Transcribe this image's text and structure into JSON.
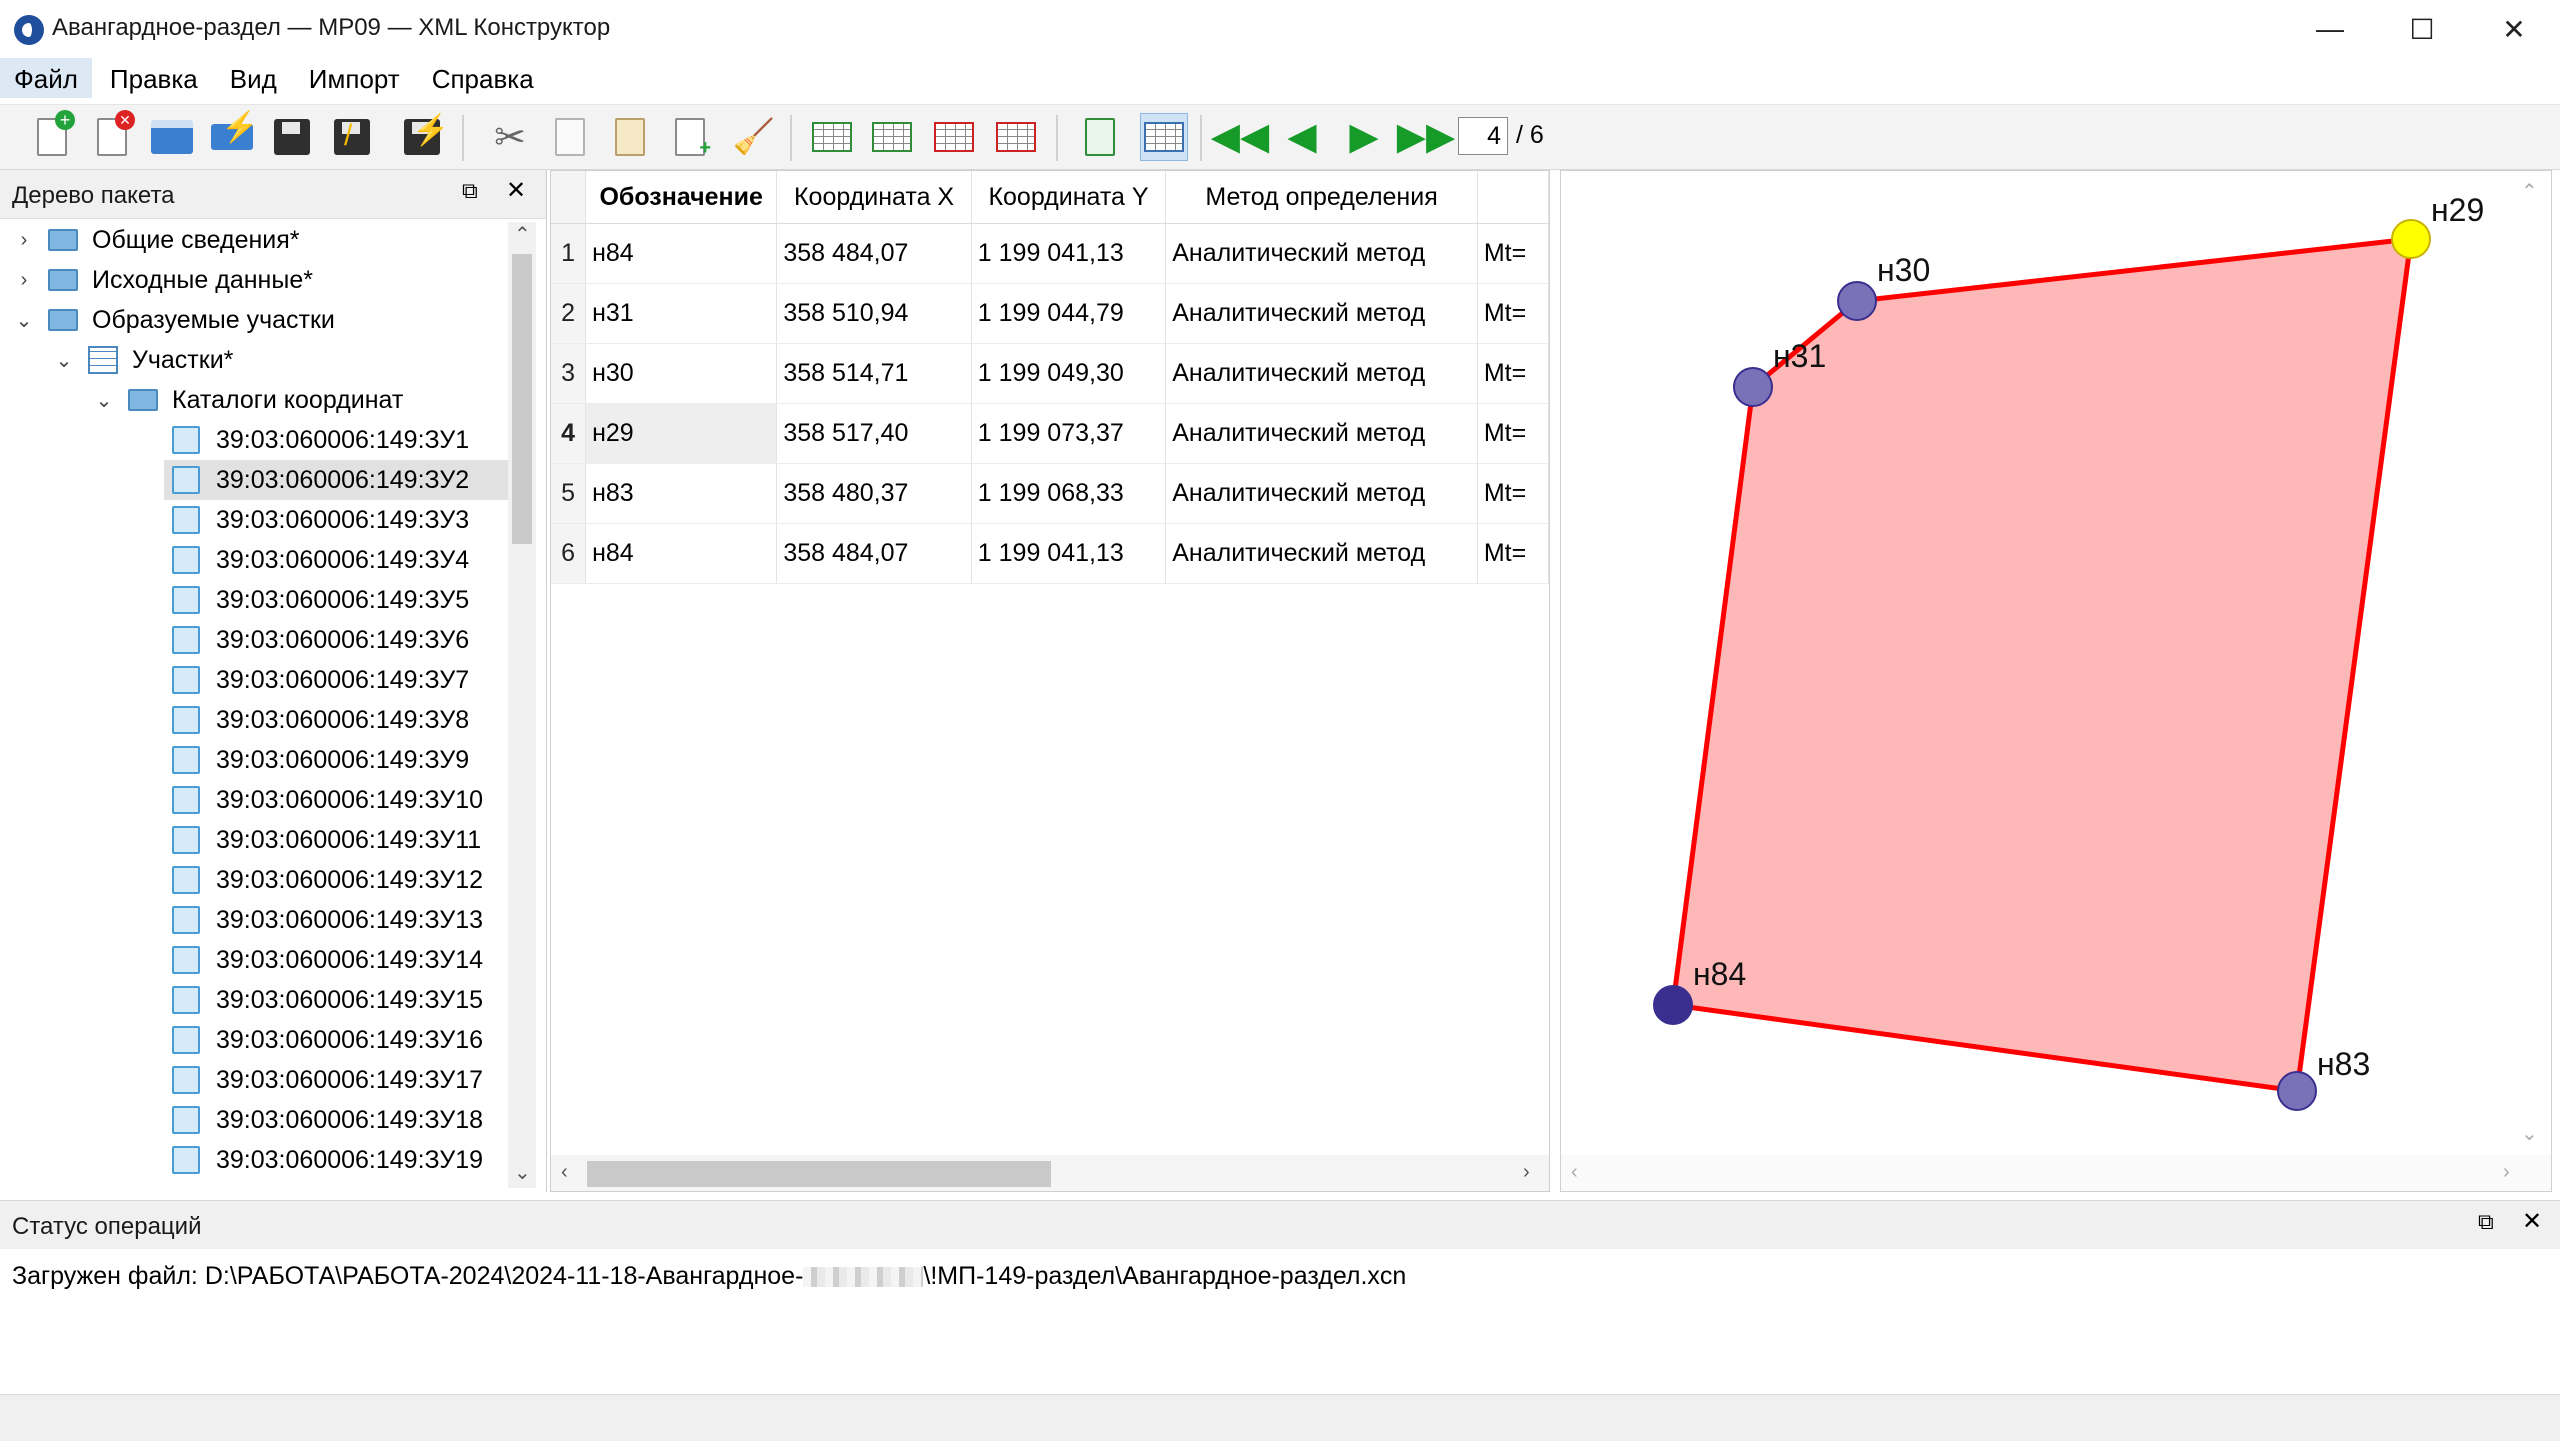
{
  "window": {
    "title": "Авангардное-раздел — МР09 — XML Конструктор",
    "min_icon": "—",
    "max_icon": "☐",
    "close_icon": "✕"
  },
  "menu": [
    "Файл",
    "Правка",
    "Вид",
    "Импорт",
    "Справка"
  ],
  "toolbar": {
    "page_current": "4",
    "page_total": "/ 6"
  },
  "tree": {
    "title": "Дерево пакета",
    "nodes": [
      {
        "label": "Общие сведения*"
      },
      {
        "label": "Исходные данные*"
      },
      {
        "label": "Образуемые участки"
      },
      {
        "label": "Участки*"
      },
      {
        "label": "Каталоги координат"
      }
    ],
    "items": [
      "39:03:060006:149:ЗУ1",
      "39:03:060006:149:ЗУ2",
      "39:03:060006:149:ЗУ3",
      "39:03:060006:149:ЗУ4",
      "39:03:060006:149:ЗУ5",
      "39:03:060006:149:ЗУ6",
      "39:03:060006:149:ЗУ7",
      "39:03:060006:149:ЗУ8",
      "39:03:060006:149:ЗУ9",
      "39:03:060006:149:ЗУ10",
      "39:03:060006:149:ЗУ11",
      "39:03:060006:149:ЗУ12",
      "39:03:060006:149:ЗУ13",
      "39:03:060006:149:ЗУ14",
      "39:03:060006:149:ЗУ15",
      "39:03:060006:149:ЗУ16",
      "39:03:060006:149:ЗУ17",
      "39:03:060006:149:ЗУ18",
      "39:03:060006:149:ЗУ19"
    ],
    "selected_index": 1
  },
  "table": {
    "headers": [
      "Обозначение",
      "Координата X",
      "Координата Y",
      "Метод определения",
      ""
    ],
    "rows": [
      {
        "n": "1",
        "name": "н84",
        "x": "358 484,07",
        "y": "1 199 041,13",
        "method": "Аналитический метод",
        "extra": "Mt="
      },
      {
        "n": "2",
        "name": "н31",
        "x": "358 510,94",
        "y": "1 199 044,79",
        "method": "Аналитический метод",
        "extra": "Mt="
      },
      {
        "n": "3",
        "name": "н30",
        "x": "358 514,71",
        "y": "1 199 049,30",
        "method": "Аналитический метод",
        "extra": "Mt="
      },
      {
        "n": "4",
        "name": "н29",
        "x": "358 517,40",
        "y": "1 199 073,37",
        "method": "Аналитический метод",
        "extra": "Mt="
      },
      {
        "n": "5",
        "name": "н83",
        "x": "358 480,37",
        "y": "1 199 068,33",
        "method": "Аналитический метод",
        "extra": "Mt="
      },
      {
        "n": "6",
        "name": "н84",
        "x": "358 484,07",
        "y": "1 199 041,13",
        "method": "Аналитический метод",
        "extra": "Mt="
      }
    ],
    "selected_row": 3
  },
  "map": {
    "fill_color": "#ffb8b8",
    "edge_color": "#ff0000",
    "point_color": "#7a72b8",
    "selected_point_color": "#ffff00",
    "points": [
      {
        "label": "н84"
      },
      {
        "label": "н31"
      },
      {
        "label": "н30"
      },
      {
        "label": "н29"
      },
      {
        "label": "н83"
      }
    ]
  },
  "status": {
    "title": "Статус операций",
    "message": "Загружен файл: D:\\РАБОТА\\РАБОТА-2024\\2024-11-18-Авангардное-",
    "message_tail": "\\!МП-149-раздел\\Авангардное-раздел.xcn"
  }
}
